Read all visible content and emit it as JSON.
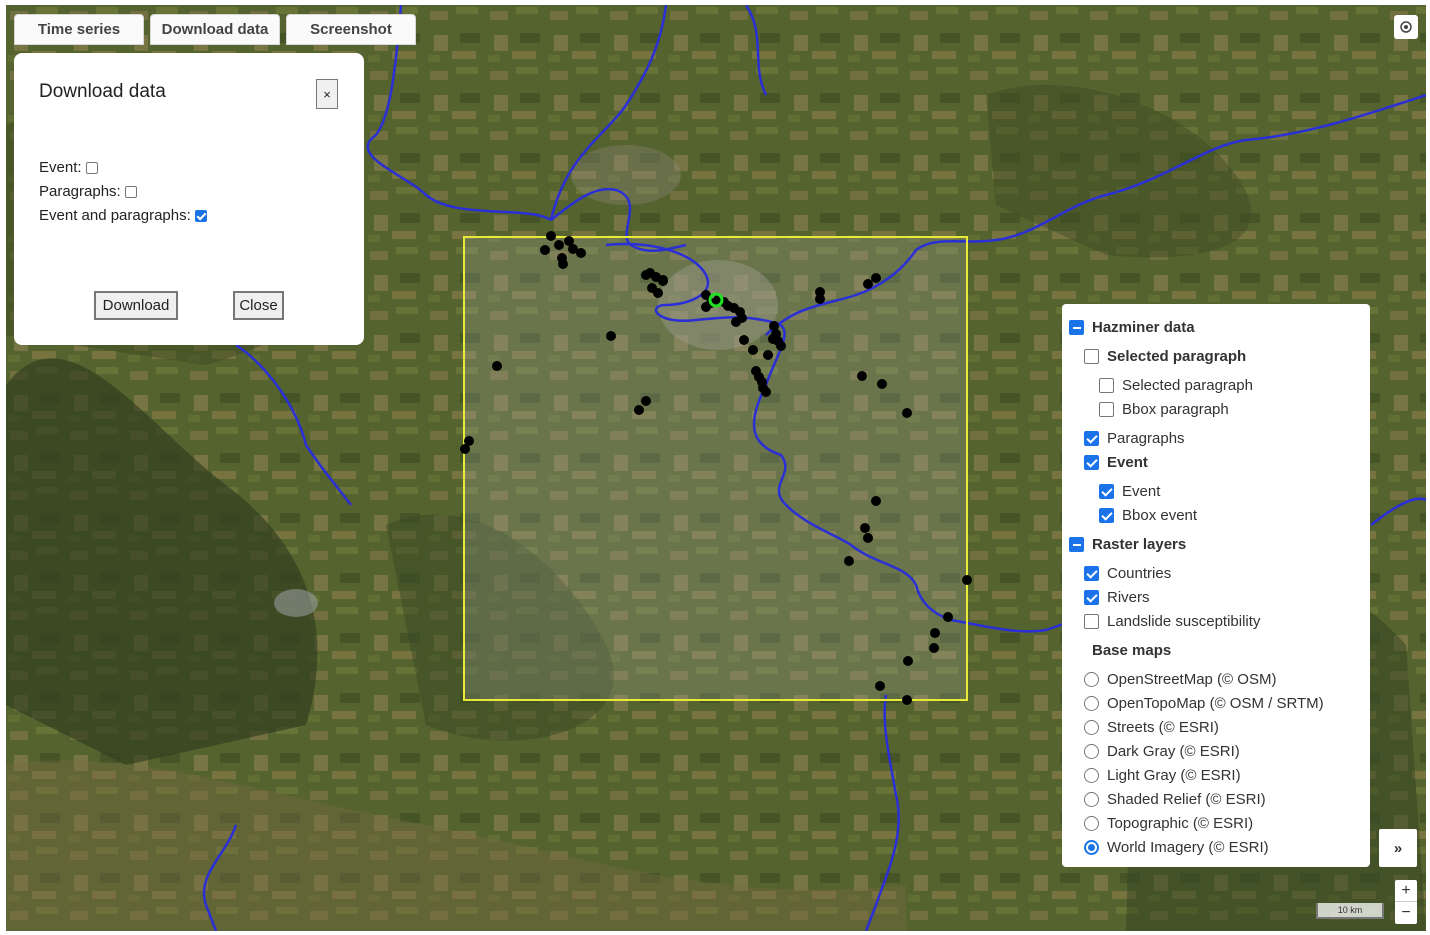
{
  "toolbar": {
    "time_series_label": "Time series",
    "download_data_label": "Download data",
    "screenshot_label": "Screenshot"
  },
  "download_panel": {
    "title": "Download data",
    "close_x": "×",
    "options": [
      {
        "label": "Event:",
        "checked": false
      },
      {
        "label": "Paragraphs:",
        "checked": false
      },
      {
        "label": "Event and paragraphs:",
        "checked": true
      }
    ],
    "download_button": "Download",
    "close_button": "Close"
  },
  "layers_panel": {
    "groups": [
      {
        "label": "Hazminer data",
        "kind": "group",
        "state": "expanded"
      },
      {
        "label": "Selected paragraph",
        "kind": "checkbox",
        "bold": true,
        "checked": false
      },
      {
        "label": "Selected paragraph",
        "kind": "checkbox",
        "bold": false,
        "checked": false
      },
      {
        "label": "Bbox paragraph",
        "kind": "checkbox",
        "bold": false,
        "checked": false
      },
      {
        "label": "Paragraphs",
        "kind": "checkbox",
        "bold": false,
        "checked": true
      },
      {
        "label": "Event",
        "kind": "checkbox",
        "bold": true,
        "checked": true
      },
      {
        "label": "Event",
        "kind": "checkbox",
        "bold": false,
        "checked": true
      },
      {
        "label": "Bbox event",
        "kind": "checkbox",
        "bold": false,
        "checked": true
      },
      {
        "label": "Raster layers",
        "kind": "group",
        "state": "expanded"
      },
      {
        "label": "Countries",
        "kind": "checkbox",
        "bold": false,
        "checked": true
      },
      {
        "label": "Rivers",
        "kind": "checkbox",
        "bold": false,
        "checked": true
      },
      {
        "label": "Landslide susceptibility",
        "kind": "checkbox",
        "bold": false,
        "checked": false
      },
      {
        "label": "Base maps",
        "kind": "heading"
      }
    ],
    "base_maps": [
      {
        "label": "OpenStreetMap (© OSM)",
        "selected": false
      },
      {
        "label": "OpenTopoMap (© OSM / SRTM)",
        "selected": false
      },
      {
        "label": "Streets (© ESRI)",
        "selected": false
      },
      {
        "label": "Dark Gray (© ESRI)",
        "selected": false
      },
      {
        "label": "Light Gray (© ESRI)",
        "selected": false
      },
      {
        "label": "Shaded Relief (© ESRI)",
        "selected": false
      },
      {
        "label": "Topographic (© ESRI)",
        "selected": false
      },
      {
        "label": "World Imagery (© ESRI)",
        "selected": true
      }
    ]
  },
  "map_controls": {
    "locate_icon": "locate-icon",
    "expand_label": "»",
    "zoom_in": "+",
    "zoom_out": "−",
    "scale_label": "10 km"
  },
  "colors": {
    "river": "#2a2fd6",
    "bbox_outline": "#e9e93a",
    "event_point": "#000000",
    "selected_point": "#22e022",
    "checkbox_accent": "#1a73e8"
  },
  "event_count_visible": 62
}
